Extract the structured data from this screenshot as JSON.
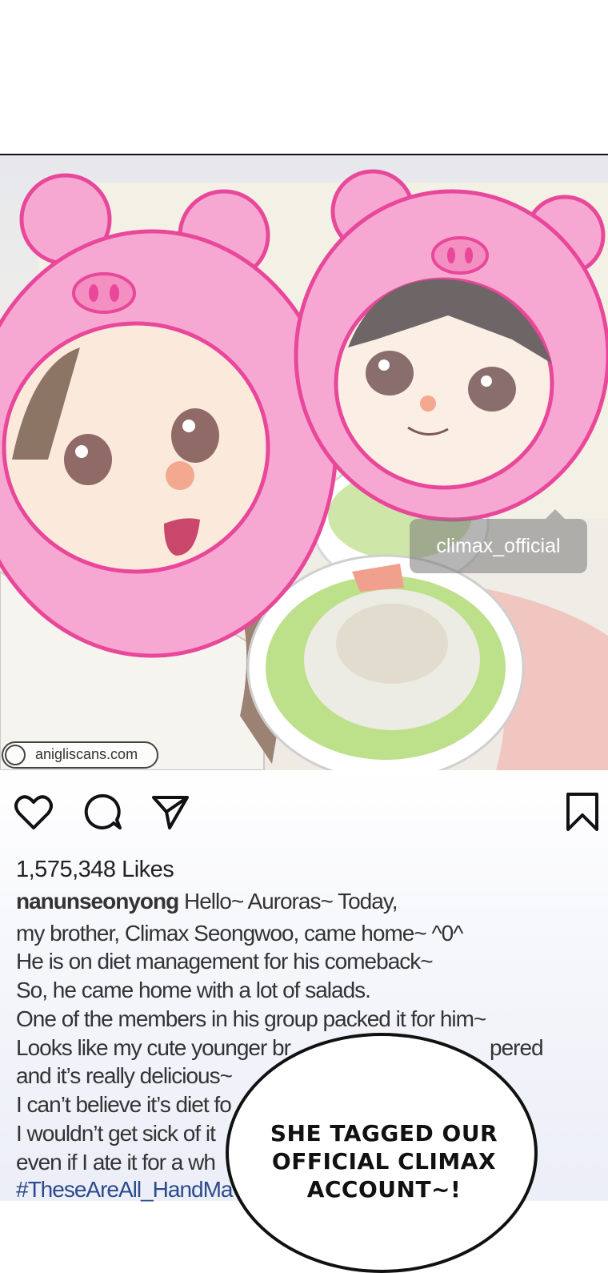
{
  "photo": {
    "tag_label": "climax_official",
    "watermark": "anigliscans.com"
  },
  "actions": {
    "like_icon": "heart-icon",
    "comment_icon": "speech-bubble-icon",
    "share_icon": "paper-plane-icon",
    "save_icon": "bookmark-icon"
  },
  "post": {
    "likes": "1,575,348 Likes",
    "username": "nanunseonyong",
    "caption_lines": [
      "Hello~ Auroras~ Today,",
      "my brother, Climax Seongwoo, came home~ ^0^",
      "He is on diet management for his comeback~",
      "So, he came home with a lot of salads.",
      "One of the members in his group packed it for him~",
      "Looks like my cute younger br",
      "pered",
      "and it’s really delicious~",
      "I can’t believe it’s diet fo",
      "I wouldn’t get sick of it",
      "even if I ate it for a wh",
      "#TheseAreAll_HandMa"
    ]
  },
  "speech_bubble": {
    "text": "SHE TAGGED OUR OFFICIAL CLIMAX ACCOUNT~!"
  },
  "colors": {
    "pig_pink": "#f7a8d2",
    "pig_outline": "#e8479a",
    "hashtag": "#2c4a8c"
  }
}
